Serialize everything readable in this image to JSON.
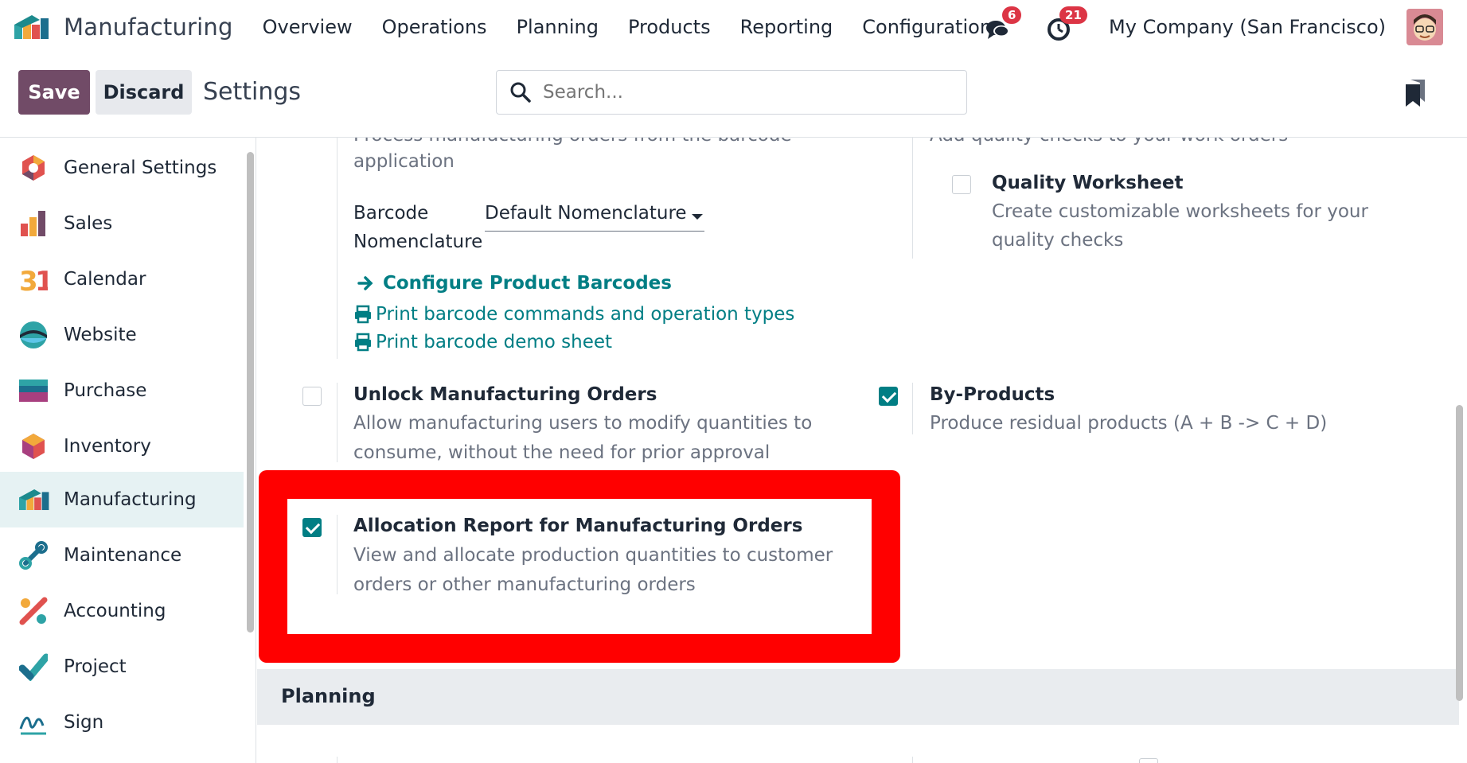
{
  "navbar": {
    "app_name": "Manufacturing",
    "menu": [
      "Overview",
      "Operations",
      "Planning",
      "Products",
      "Reporting",
      "Configuration"
    ],
    "messages_count": "6",
    "activities_count": "21",
    "company": "My Company (San Francisco)"
  },
  "control": {
    "save_label": "Save",
    "discard_label": "Discard",
    "title": "Settings",
    "search_placeholder": "Search..."
  },
  "sidebar": {
    "items": [
      {
        "label": "General Settings",
        "icon": "general-settings-icon"
      },
      {
        "label": "Sales",
        "icon": "sales-icon"
      },
      {
        "label": "Calendar",
        "icon": "calendar-icon"
      },
      {
        "label": "Website",
        "icon": "website-icon"
      },
      {
        "label": "Purchase",
        "icon": "purchase-icon"
      },
      {
        "label": "Inventory",
        "icon": "inventory-icon"
      },
      {
        "label": "Manufacturing",
        "icon": "manufacturing-icon",
        "active": true
      },
      {
        "label": "Maintenance",
        "icon": "maintenance-icon"
      },
      {
        "label": "Accounting",
        "icon": "accounting-icon"
      },
      {
        "label": "Project",
        "icon": "project-icon"
      },
      {
        "label": "Sign",
        "icon": "sign-icon"
      }
    ]
  },
  "settings": {
    "barcode_desc_line1": "Process manufacturing orders from the barcode",
    "barcode_desc_line2": "application",
    "barcode_label_line1": "Barcode",
    "barcode_label_line2": "Nomenclature",
    "barcode_value": "Default Nomenclature",
    "configure_barcodes": "Configure Product Barcodes",
    "print_commands": "Print barcode commands and operation types",
    "print_demo": "Print barcode demo sheet",
    "quality_desc_top": "Add quality checks to your work orders",
    "quality_worksheet_title": "Quality Worksheet",
    "quality_worksheet_desc1": "Create customizable worksheets for your",
    "quality_worksheet_desc2": "quality checks",
    "unlock_title": "Unlock Manufacturing Orders",
    "unlock_desc1": "Allow manufacturing users to modify quantities to",
    "unlock_desc2": "consume, without the need for prior approval",
    "byproducts_title": "By-Products",
    "byproducts_desc": "Produce residual products (A + B -> C + D)",
    "allocation_title": "Allocation Report for Manufacturing Orders",
    "allocation_desc1": "View and allocate production quantities to customer",
    "allocation_desc2": "orders or other manufacturing orders",
    "planning_section": "Planning"
  },
  "colors": {
    "accent": "#017e84",
    "brand": "#714b67",
    "highlight": "#ff0000"
  }
}
